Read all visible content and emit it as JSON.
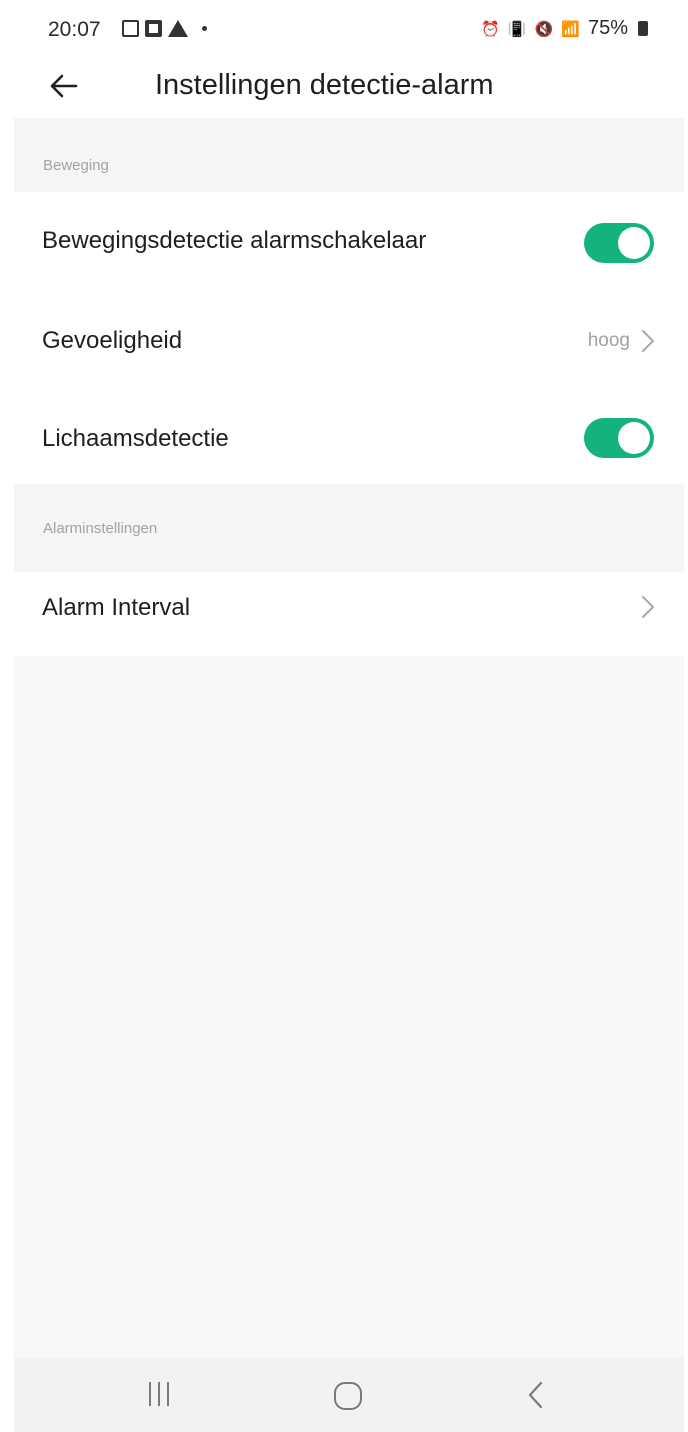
{
  "status_bar": {
    "time": "20:07",
    "battery": "75%",
    "left_icons": [
      "gallery-icon",
      "linkedin-icon",
      "warning-icon",
      "dot-icon"
    ],
    "right_icons": [
      "alarm-icon",
      "vibrate-icon",
      "mute-icon",
      "wifi-icon",
      "signal-icon",
      "battery-icon"
    ]
  },
  "header": {
    "title": "Instellingen detectie-alarm"
  },
  "sections": [
    {
      "title": "Beweging",
      "items": [
        {
          "label": "Bewegingsdetectie alarmschakelaar",
          "type": "toggle",
          "on": true
        },
        {
          "label": "Gevoeligheid",
          "type": "value",
          "value": "hoog"
        },
        {
          "label": "Lichaamsdetectie",
          "type": "toggle",
          "on": true
        }
      ]
    },
    {
      "title": "Alarminstellingen",
      "items": [
        {
          "label": "Alarm Interval",
          "type": "link"
        }
      ]
    }
  ],
  "colors": {
    "toggle_on": "#14b37d",
    "background": "#f8f8f9",
    "section_text": "#a3a3a3"
  },
  "nav_bar": [
    "recents-icon",
    "home-icon",
    "back-icon"
  ]
}
